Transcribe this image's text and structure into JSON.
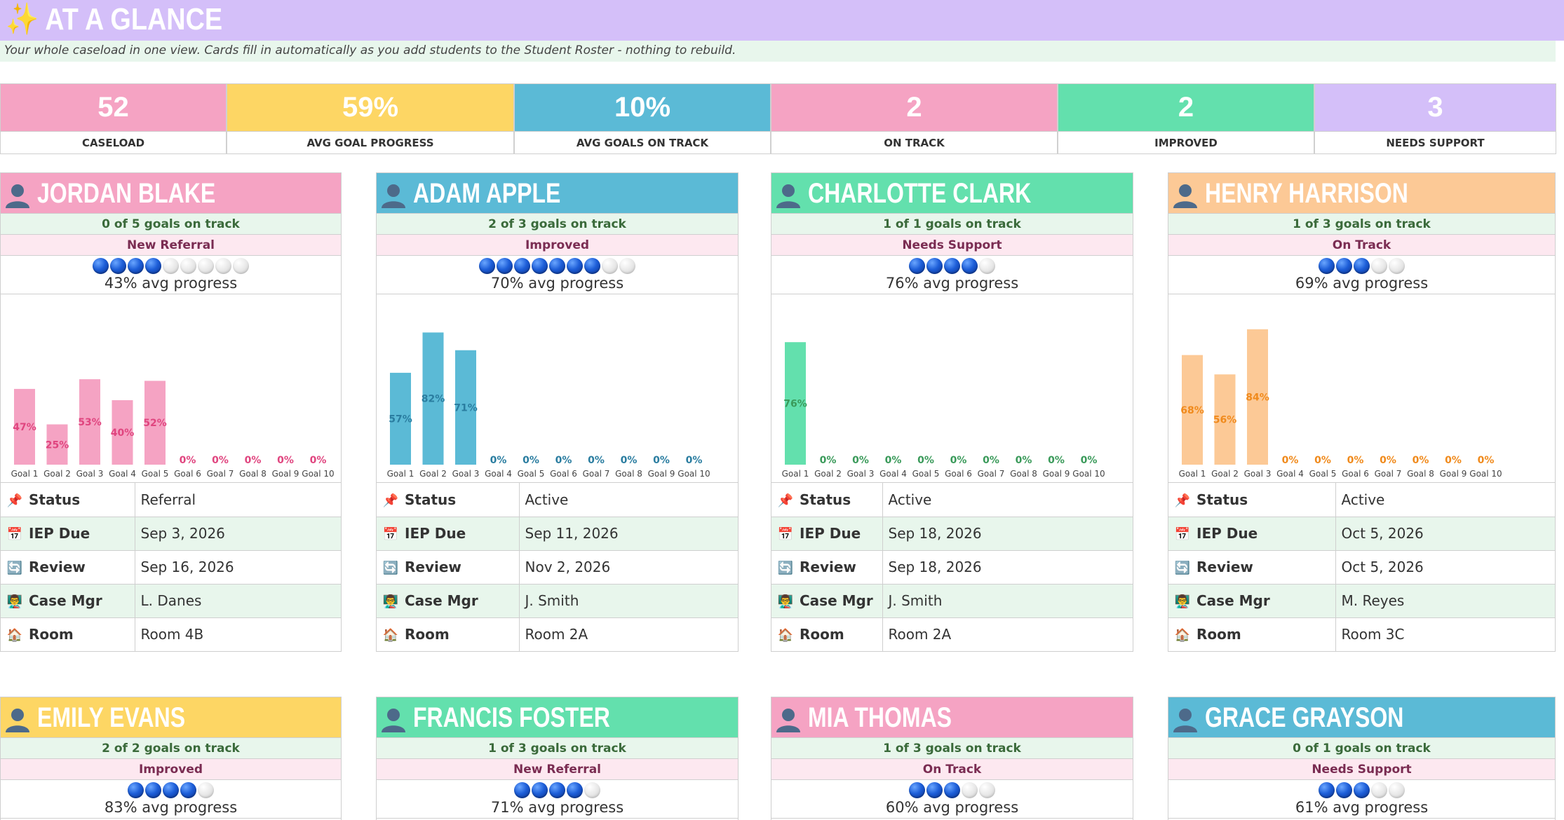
{
  "banner": {
    "icon": "sparkles-icon",
    "title": "✨ AT A GLANCE"
  },
  "subtitle": "Your whole caseload in one view. Cards fill in automatically as you add students to the Student Roster - nothing to rebuild.",
  "stats": [
    {
      "value": "52",
      "label": "CASELOAD",
      "color": "#f5a3c3"
    },
    {
      "value": "59%",
      "label": "AVG GOAL PROGRESS",
      "color": "#fdd664"
    },
    {
      "value": "10%",
      "label": "AVG GOALS ON TRACK",
      "color": "#5bbad6"
    },
    {
      "value": "2",
      "label": "ON TRACK",
      "color": "#f5a3c3"
    },
    {
      "value": "2",
      "label": "IMPROVED",
      "color": "#63e0ad"
    },
    {
      "value": "3",
      "label": "NEEDS SUPPORT",
      "color": "#d4bff9"
    }
  ],
  "field_labels": {
    "status": "Status",
    "iep_due": "IEP Due",
    "review": "Review",
    "case_mgr": "Case Mgr",
    "room": "Room"
  },
  "field_icons": {
    "status": "pushpin-icon",
    "iep_due": "calendar-icon",
    "review": "refresh-icon",
    "case_mgr": "teacher-icon",
    "room": "house-icon"
  },
  "goal_labels": [
    "Goal 1",
    "Goal 2",
    "Goal 3",
    "Goal 4",
    "Goal 5",
    "Goal 6",
    "Goal 7",
    "Goal 8",
    "Goal 9",
    "Goal 10"
  ],
  "students": [
    {
      "name": "JORDAN BLAKE",
      "color": "#f5a3c3",
      "text_color": "#e0457f",
      "on_track": "0 of 5 goals on track",
      "tag": "New Referral",
      "dots_on": 4,
      "dots_total": 9,
      "avg": "43% avg progress",
      "chart_data": {
        "type": "bar",
        "categories": [
          "Goal 1",
          "Goal 2",
          "Goal 3",
          "Goal 4",
          "Goal 5",
          "Goal 6",
          "Goal 7",
          "Goal 8",
          "Goal 9",
          "Goal 10"
        ],
        "values": [
          47,
          25,
          53,
          40,
          52,
          0,
          0,
          0,
          0,
          0
        ]
      },
      "status": "Referral",
      "iep_due": "Sep 3, 2026",
      "review": "Sep 16, 2026",
      "case_mgr": "L. Danes",
      "room": "Room 4B"
    },
    {
      "name": "ADAM APPLE",
      "color": "#5bbad6",
      "text_color": "#2a7da0",
      "on_track": "2 of 3 goals on track",
      "tag": "Improved",
      "dots_on": 7,
      "dots_total": 9,
      "avg": "70% avg progress",
      "chart_data": {
        "type": "bar",
        "categories": [
          "Goal 1",
          "Goal 2",
          "Goal 3",
          "Goal 4",
          "Goal 5",
          "Goal 6",
          "Goal 7",
          "Goal 8",
          "Goal 9",
          "Goal 10"
        ],
        "values": [
          57,
          82,
          71,
          0,
          0,
          0,
          0,
          0,
          0,
          0
        ]
      },
      "status": "Active",
      "iep_due": "Sep 11, 2026",
      "review": "Nov 2, 2026",
      "case_mgr": "J. Smith",
      "room": "Room 2A"
    },
    {
      "name": "CHARLOTTE CLARK",
      "color": "#63e0ad",
      "text_color": "#3a9a5a",
      "on_track": "1 of 1 goals on track",
      "tag": "Needs Support",
      "dots_on": 4,
      "dots_total": 5,
      "avg": "76% avg progress",
      "chart_data": {
        "type": "bar",
        "categories": [
          "Goal 1",
          "Goal 2",
          "Goal 3",
          "Goal 4",
          "Goal 5",
          "Goal 6",
          "Goal 7",
          "Goal 8",
          "Goal 9",
          "Goal 10"
        ],
        "values": [
          76,
          0,
          0,
          0,
          0,
          0,
          0,
          0,
          0,
          0
        ]
      },
      "status": "Active",
      "iep_due": "Sep 18, 2026",
      "review": "Sep 18, 2026",
      "case_mgr": "J. Smith",
      "room": "Room 2A"
    },
    {
      "name": "HENRY HARRISON",
      "color": "#fcc996",
      "text_color": "#f08a1c",
      "on_track": "1 of 3 goals on track",
      "tag": "On Track",
      "dots_on": 3,
      "dots_total": 5,
      "avg": "69% avg progress",
      "chart_data": {
        "type": "bar",
        "categories": [
          "Goal 1",
          "Goal 2",
          "Goal 3",
          "Goal 4",
          "Goal 5",
          "Goal 6",
          "Goal 7",
          "Goal 8",
          "Goal 9",
          "Goal 10"
        ],
        "values": [
          68,
          56,
          84,
          0,
          0,
          0,
          0,
          0,
          0,
          0
        ]
      },
      "status": "Active",
      "iep_due": "Oct 5, 2026",
      "review": "Oct 5, 2026",
      "case_mgr": "M. Reyes",
      "room": "Room 3C"
    },
    {
      "name": "EMILY EVANS",
      "color": "#fdd664",
      "text_color": "#b88a00",
      "on_track": "2 of 2 goals on track",
      "tag": "Improved",
      "dots_on": 4,
      "dots_total": 5,
      "avg": "83% avg progress"
    },
    {
      "name": "FRANCIS FOSTER",
      "color": "#63e0ad",
      "text_color": "#3a9a5a",
      "on_track": "1 of 3 goals on track",
      "tag": "New Referral",
      "dots_on": 4,
      "dots_total": 5,
      "avg": "71% avg progress"
    },
    {
      "name": "MIA THOMAS",
      "color": "#f5a3c3",
      "text_color": "#e0457f",
      "on_track": "1 of 3 goals on track",
      "tag": "On Track",
      "dots_on": 3,
      "dots_total": 5,
      "avg": "60% avg progress"
    },
    {
      "name": "GRACE GRAYSON",
      "color": "#5bbad6",
      "text_color": "#2a7da0",
      "on_track": "0 of 1 goals on track",
      "tag": "Needs Support",
      "dots_on": 3,
      "dots_total": 5,
      "avg": "61% avg progress"
    }
  ]
}
